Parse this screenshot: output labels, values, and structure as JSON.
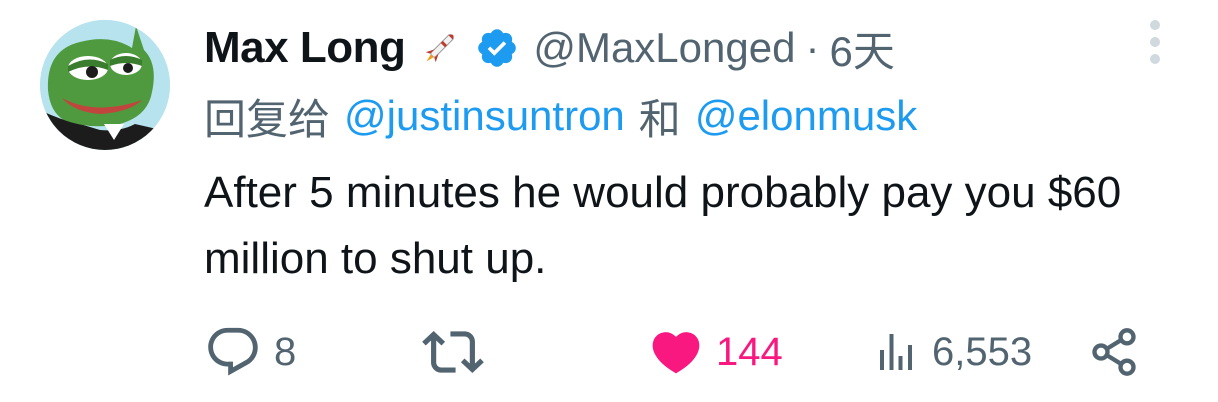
{
  "tweet": {
    "author_name": "Max Long",
    "handle": "@MaxLonged",
    "separator": "·",
    "time": "6天",
    "reply_prefix": "回复给",
    "reply_to_1": "@justinsuntron",
    "reply_joiner": "和",
    "reply_to_2": "@elonmusk",
    "text": "After 5 minutes he would probably pay you $60 million to shut up.",
    "badges": [
      "rocket-icon",
      "verified-icon"
    ]
  },
  "actions": {
    "replies": "8",
    "retweets": "",
    "likes": "144",
    "liked": true,
    "views": "6,553"
  },
  "colors": {
    "link": "#1d9bf0",
    "secondary_text": "#536471",
    "like": "#f91880",
    "verified": "#1d9bf0",
    "avatar_bg": "#b6e3ee"
  }
}
